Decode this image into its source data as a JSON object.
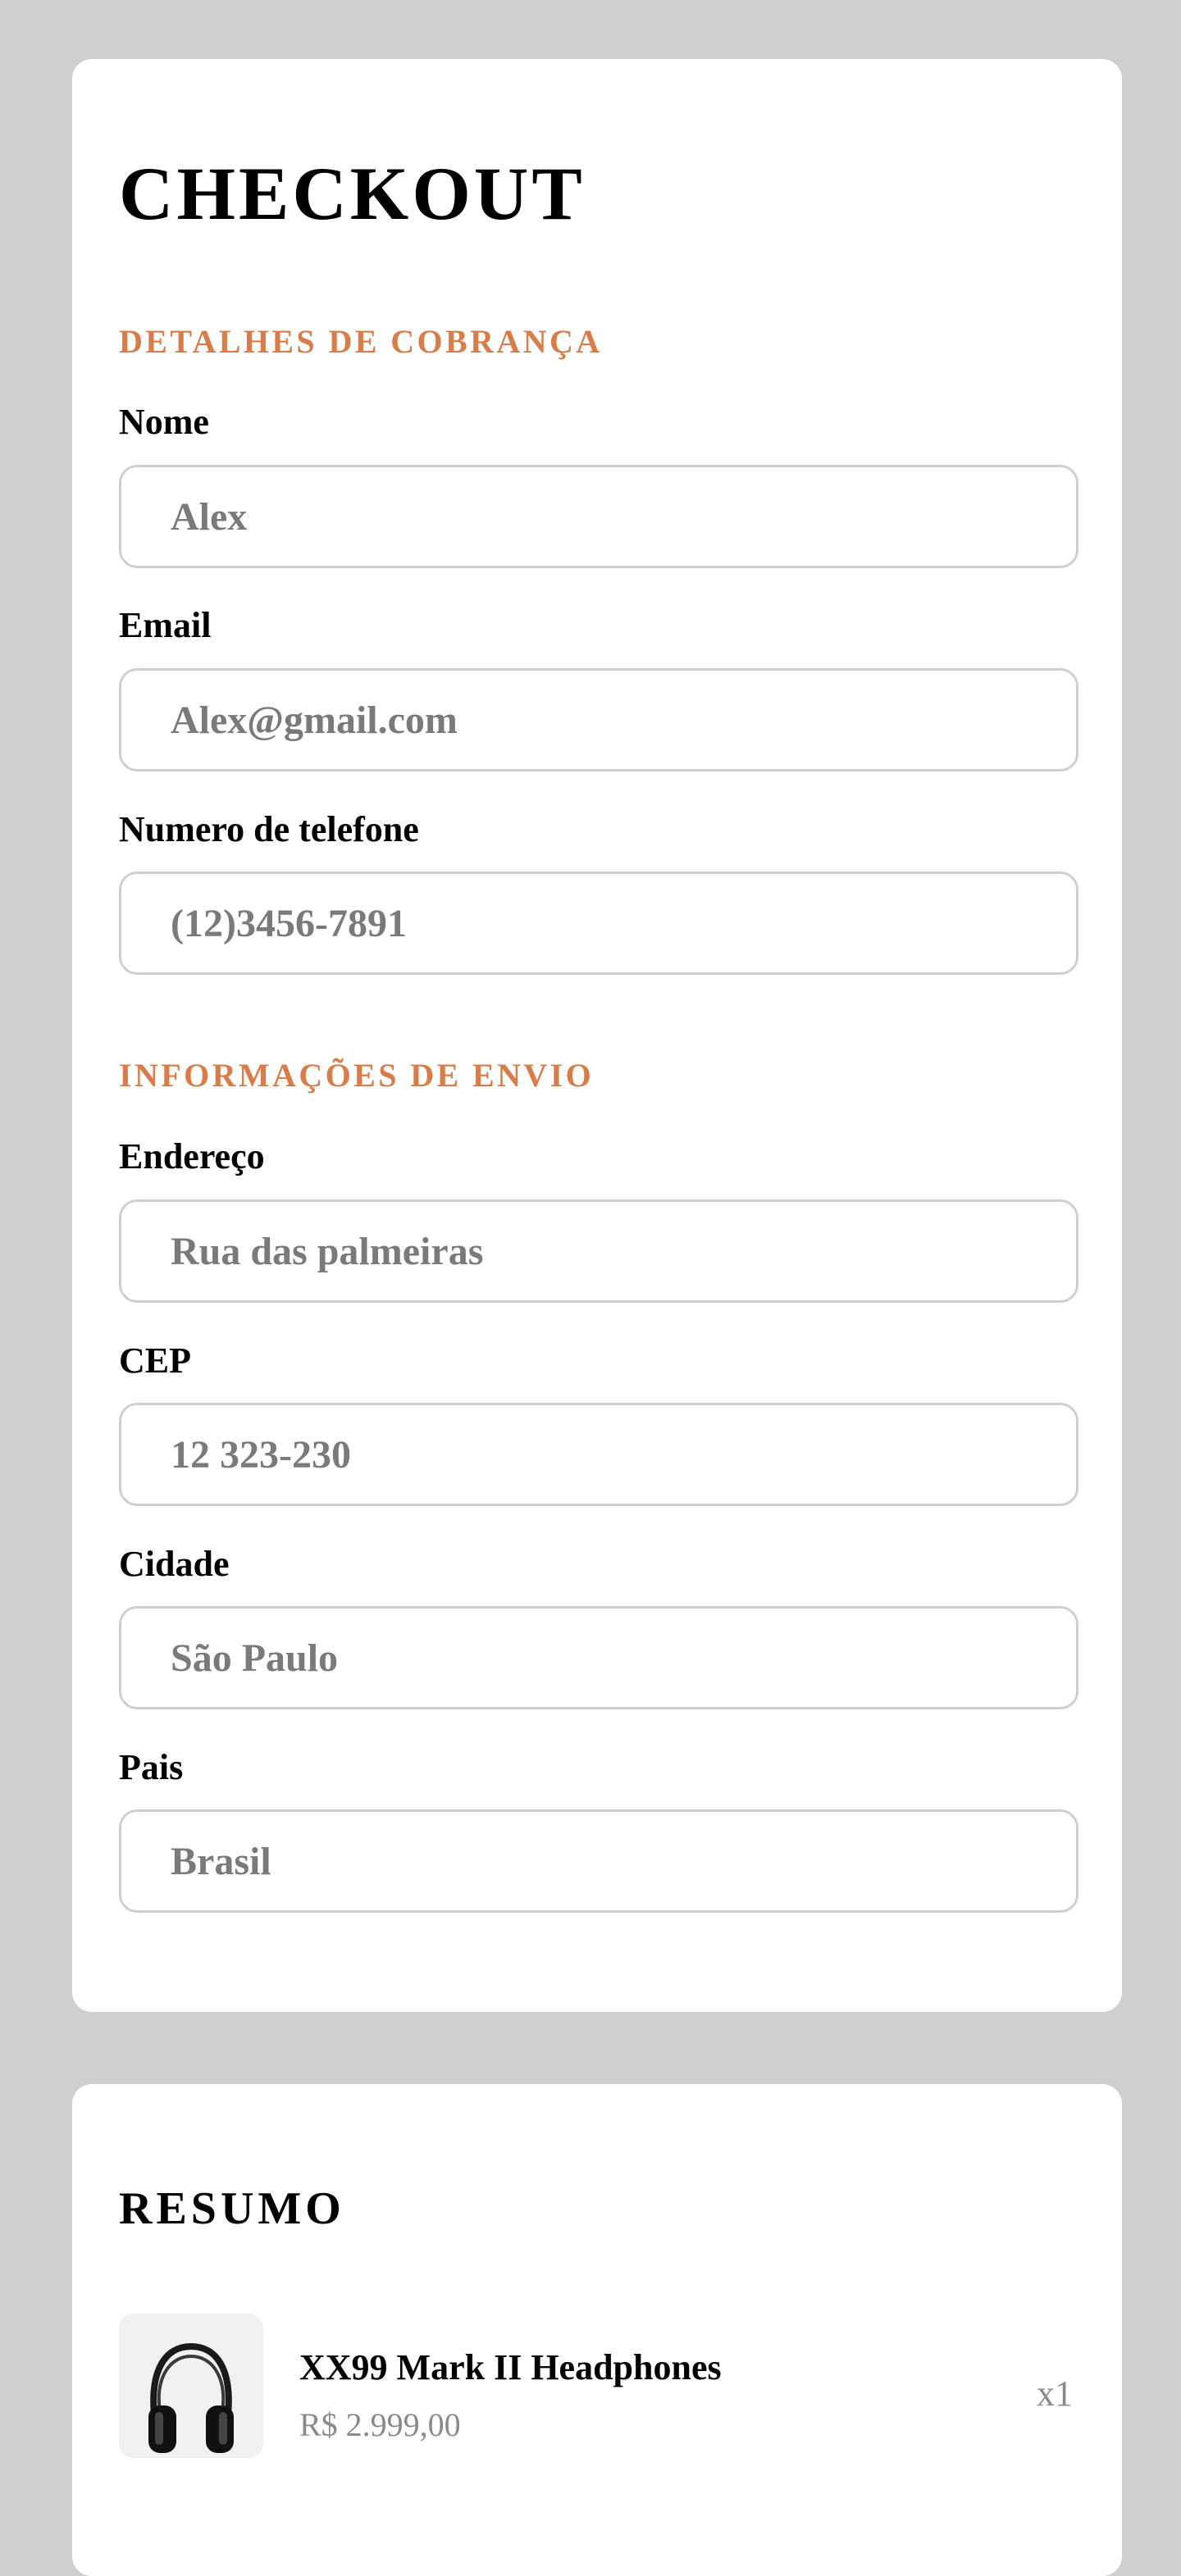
{
  "checkout": {
    "title": "CHECKOUT",
    "billing": {
      "heading": "DETALHES DE COBRANÇA",
      "name": {
        "label": "Nome",
        "placeholder": "Alex"
      },
      "email": {
        "label": "Email",
        "placeholder": "Alex@gmail.com"
      },
      "phone": {
        "label": "Numero de telefone",
        "placeholder": "(12)3456-7891"
      }
    },
    "shipping": {
      "heading": "INFORMAÇÕES DE ENVIO",
      "address": {
        "label": "Endereço",
        "placeholder": "Rua das palmeiras"
      },
      "zip": {
        "label": "CEP",
        "placeholder": "12 323-230"
      },
      "city": {
        "label": "Cidade",
        "placeholder": "São Paulo"
      },
      "country": {
        "label": "Pais",
        "placeholder": "Brasil"
      }
    }
  },
  "summary": {
    "title": "RESUMO",
    "items": [
      {
        "name": "XX99 Mark II Headphones",
        "price": "R$ 2.999,00",
        "quantity": "x1",
        "icon": "headphones-icon"
      }
    ]
  },
  "colors": {
    "accent": "#d87d4a",
    "background": "#cfcfcf",
    "card": "#ffffff",
    "input_border": "#cfcfcf",
    "placeholder": "#7a7a7a"
  }
}
